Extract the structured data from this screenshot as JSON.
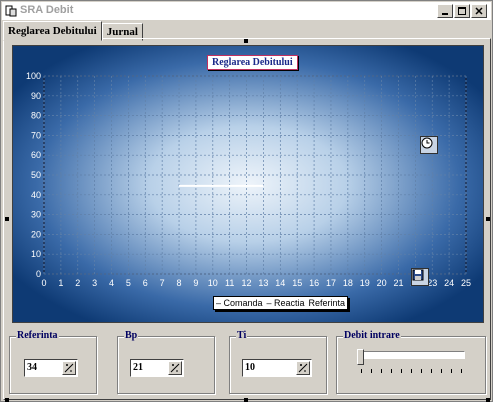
{
  "window": {
    "title": "SRA Debit"
  },
  "tabs": [
    {
      "label": "Reglarea Debitului",
      "active": true
    },
    {
      "label": "Jurnal",
      "active": false
    }
  ],
  "chart_data": {
    "type": "line",
    "title": "Reglarea Debitului",
    "xlabel": "",
    "ylabel": "",
    "xlim": [
      0,
      25
    ],
    "ylim": [
      0,
      100
    ],
    "x_ticks": [
      "0",
      "1",
      "2",
      "3",
      "4",
      "5",
      "6",
      "7",
      "8",
      "9",
      "10",
      "11",
      "12",
      "13",
      "14",
      "15",
      "16",
      "17",
      "18",
      "19",
      "20",
      "21",
      "22",
      "23",
      "24",
      "25"
    ],
    "y_ticks": [
      "0",
      "10",
      "20",
      "30",
      "40",
      "50",
      "60",
      "70",
      "80",
      "90",
      "100"
    ],
    "grid": true,
    "legend_position": "bottom",
    "series": [
      {
        "name": "Comanda",
        "x": [],
        "y": []
      },
      {
        "name": "Reactia",
        "x": [],
        "y": []
      },
      {
        "name": "Referinta",
        "x": [
          8,
          13
        ],
        "y": [
          44.5,
          44.5
        ]
      }
    ]
  },
  "legend": [
    "– Comanda",
    "– Reactia",
    "Referinta"
  ],
  "icons": {
    "clock": "clock-icon",
    "save": "floppy-disk-icon"
  },
  "controls": {
    "referinta": {
      "label": "Referinta",
      "value": "34"
    },
    "bp": {
      "label": "Bp",
      "value": "21"
    },
    "ti": {
      "label": "Ti",
      "value": "10"
    },
    "debit_intrare": {
      "label": "Debit intrare",
      "value": 0
    }
  },
  "colors": {
    "chart_bg": "#0e3a74",
    "chart_center": "#e8f0f8",
    "accent": "#1a2a8a"
  }
}
